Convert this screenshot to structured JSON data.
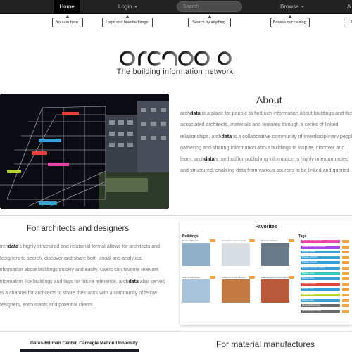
{
  "nav": {
    "home_label": "Home",
    "login_label": "Login",
    "search_placeholder": "Search",
    "browse_label": "Browse",
    "about_label": "A"
  },
  "tooltips": {
    "home": "You are here.",
    "login": "Login and favorite things.",
    "search": "Search by anything.",
    "browse": "Browse our catalog.",
    "about": "Wh"
  },
  "brand": {
    "logo_text": "archdata",
    "tagline": "The building information network."
  },
  "hero": {
    "labels": [
      "Metal Panel",
      "Coating - Glass",
      "Overview",
      "Steel Beam",
      "Grass",
      "Concrete"
    ],
    "label_colors": [
      "#e8413b",
      "#3aa0d8",
      "#e8413b",
      "#e845a8",
      "#b8d431",
      "#3aa0d8"
    ]
  },
  "about": {
    "title": "About",
    "p1_brand": "arch",
    "p1_brand_bold": "data",
    "p1_text": " is a place for people to find rich information about buildings and their associated architects, materials and features through a series of linked relationships. ",
    "p2_brand": "arch",
    "p2_brand_bold": "data",
    "p2_text": " is a collaborative community of interdisciplinary people gathering and sharing information about buildings to inspire, discover and learn. ",
    "p3_brand": "arch",
    "p3_brand_bold": "data",
    "p3_text": "'s method for publishing information is highly interconnected and structured, enabling data from various sources to be linked and queried."
  },
  "architects": {
    "title": "For architects and designers",
    "p1_brand": "arch",
    "p1_brand_bold": "data",
    "p1_text": "'s highly structured and relational format allows for architects and designers to search, discover and share both visual and analytical information about buildings quickly and easily. Users can favorite relevant information like buildings and tags for future reference. ",
    "p2_brand": "arch",
    "p2_brand_bold": "data",
    "p2_text": " also serves as a channel for architects to share their work with a community of fellow designers, enthusiasts and potential clients."
  },
  "favorites": {
    "title": "Favorites",
    "buildings_label": "Buildings",
    "tags_label": "Tags",
    "buildings": [
      {
        "name": "Denmark Pavilion",
        "color": "#8fb0c8"
      },
      {
        "name": "Guangzhou Opera House",
        "color": "#d8dde2"
      },
      {
        "name": "Burnham Pavilion",
        "color": "#6b7a88"
      },
      {
        "name": "Oslo Opera House",
        "color": "#a8c4d8"
      },
      {
        "name": "Orbital Art & City Museum",
        "color": "#c27a42"
      },
      {
        "name": "Stall Dengsthe Patina Cultural",
        "color": "#b85a3a"
      }
    ],
    "tags": [
      {
        "label": "Cantilevered Steel Frame",
        "color": "#e845a8"
      },
      {
        "label": "Cantilevered Tilt-up Concrete",
        "color": "#a845e8"
      },
      {
        "label": "Material: Copper",
        "color": "#3aa0d8"
      },
      {
        "label": "Material: Aluminum",
        "color": "#3aa0d8"
      },
      {
        "label": "Material: Concrete",
        "color": "#3aa0d8"
      },
      {
        "label": "Material: Concrete - Colored",
        "color": "#3aa0d8"
      },
      {
        "label": "Material: Stone",
        "color": "#3ac8b8"
      },
      {
        "label": "Material: Glass",
        "color": "#3aa0d8"
      },
      {
        "label": "Pyrolytic Graphite",
        "color": "#e8413b"
      },
      {
        "label": "Material: Steel",
        "color": "#3aa0d8"
      },
      {
        "label": "Material: Wood",
        "color": "#b8d431"
      },
      {
        "label": "Material: Paint",
        "color": "#3aa0d8"
      },
      {
        "label": "Structural Steel Frame",
        "color": "#6b6b6b"
      },
      {
        "label": "Structural Wood Frame",
        "color": "#6b6b6b"
      }
    ]
  },
  "bottom": {
    "building_caption": "Gates-Hillman Center, Carnegie Mellon University",
    "materials_title": "For material manufactures"
  }
}
